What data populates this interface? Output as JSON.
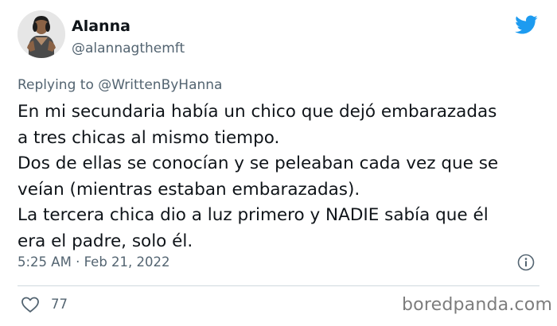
{
  "tweet": {
    "author_name": "Alanna",
    "author_handle": "@alannagthemft",
    "replying_to_prefix": "Replying to",
    "replying_to_handle": "@WrittenByHanna",
    "text_lines": [
      "En mi secundaria había un chico que dejó embarazadas",
      "a tres chicas al mismo tiempo.",
      "Dos de ellas se conocían y se peleaban cada vez que se",
      "veían (mientras estaban embarazadas).",
      "La tercera chica dio a luz primero y NADIE sabía que él",
      "era el padre, solo él."
    ],
    "time": "5:25 AM",
    "separator": "·",
    "date": "Feb 21, 2022",
    "like_count": "77"
  },
  "watermark": "boredpanda.com",
  "icons": {
    "brand": "twitter-bird-icon",
    "info": "info-icon",
    "like": "heart-icon"
  },
  "colors": {
    "twitter_blue": "#1d9bf0",
    "text_primary": "#0f1419",
    "text_secondary": "#536471",
    "divider": "#cfd9de"
  }
}
